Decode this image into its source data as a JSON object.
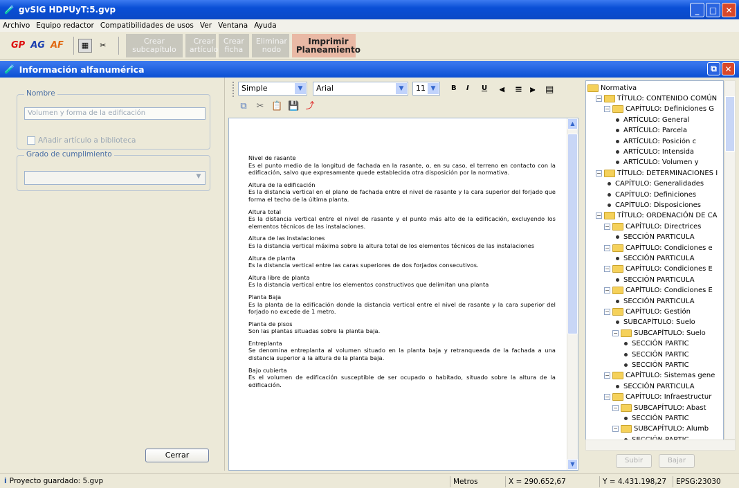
{
  "window": {
    "title": "gvSIG HDPUyT:5.gvp"
  },
  "menu": [
    "Archivo",
    "Equipo redactor",
    "Compatibilidades de usos",
    "Ver",
    "Ventana",
    "Ayuda"
  ],
  "toolbar": {
    "logos": [
      "GP",
      "AG",
      "AF"
    ],
    "buttons": [
      {
        "label": "Crear subcapítulo",
        "enabled": false
      },
      {
        "label": "Crear artículo",
        "enabled": false
      },
      {
        "label": "Crear ficha",
        "enabled": false
      },
      {
        "label": "Eliminar nodo",
        "enabled": false
      },
      {
        "label": "Imprimir Planeamiento",
        "enabled": true
      }
    ]
  },
  "frame": {
    "title": "Información alfanumérica"
  },
  "left": {
    "nombre_legend": "Nombre",
    "nombre_value": "Volumen y forma de la edificación",
    "add_checkbox": "Añadir artículo a biblioteca",
    "grado_legend": "Grado de cumplimiento",
    "grado_value": "",
    "close_label": "Cerrar"
  },
  "editor": {
    "style": "Simple",
    "font": "Arial",
    "size": "11",
    "format_buttons": [
      "B",
      "I",
      "U"
    ],
    "entries": [
      {
        "title": "Nivel de rasante",
        "text": "Es el punto medio de la longitud de fachada en la rasante, o, en su caso, el terreno en contacto con la edificación, salvo que expresamente quede establecida otra disposición por la normativa."
      },
      {
        "title": "Altura de la edificación",
        "text": "Es la distancia vertical en el plano de fachada entre el nivel de rasante y la cara superior del forjado que forma el techo de la última planta."
      },
      {
        "title": "Altura total",
        "text": "Es la distancia vertical entre el nivel de rasante y el punto más alto de la edificación, excluyendo los elementos técnicos de las instalaciones."
      },
      {
        "title": "Altura de las instalaciones",
        "text": "Es la distancia vertical máxima sobre la altura total de los elementos técnicos de las instalaciones"
      },
      {
        "title": "Altura de planta",
        "text": "Es la distancia vertical entre las caras superiores de dos forjados consecutivos."
      },
      {
        "title": "Altura libre de planta",
        "text": "Es la distancia vertical entre los elementos constructivos que delimitan una planta"
      },
      {
        "title": "Planta Baja",
        "text": "Es la planta de la edificación donde la distancia vertical entre el nivel de rasante y la cara superior del forjado no excede de 1 metro."
      },
      {
        "title": "Planta de pisos",
        "text": "Son las plantas situadas sobre la planta baja."
      },
      {
        "title": "Entreplanta",
        "text": "Se denomina entreplanta al volumen situado en la planta baja y retranqueada de la fachada a una distancia superior a la altura de la planta baja."
      },
      {
        "title": "Bajo cubierta",
        "text": "Es el volumen de edificación susceptible de ser ocupado o habitado, situado sobre la altura de la edificación."
      }
    ]
  },
  "tree": {
    "nodes": [
      {
        "label": "Normativa",
        "level": 0,
        "kind": "folder",
        "toggle": ""
      },
      {
        "label": "TÍTULO: CONTENIDO COMÚN",
        "level": 1,
        "kind": "folder",
        "toggle": "−"
      },
      {
        "label": "CAPÍTULO: Definiciones G",
        "level": 2,
        "kind": "folder",
        "toggle": "−"
      },
      {
        "label": "ARTÍCULO: General",
        "level": 3,
        "kind": "leaf",
        "toggle": ""
      },
      {
        "label": "ARTÍCULO: Parcela",
        "level": 3,
        "kind": "leaf",
        "toggle": ""
      },
      {
        "label": "ARTÍCULO: Posición c",
        "level": 3,
        "kind": "leaf",
        "toggle": ""
      },
      {
        "label": "ARTÍCULO: Intensida",
        "level": 3,
        "kind": "leaf",
        "toggle": ""
      },
      {
        "label": "ARTÍCULO: Volumen y",
        "level": 3,
        "kind": "leaf",
        "toggle": ""
      },
      {
        "label": "TÍTULO: DETERMINACIONES I",
        "level": 1,
        "kind": "folder",
        "toggle": "−"
      },
      {
        "label": "CAPÍTULO: Generalidades",
        "level": 2,
        "kind": "leaf",
        "toggle": ""
      },
      {
        "label": "CAPÍTULO: Definiciones",
        "level": 2,
        "kind": "leaf",
        "toggle": ""
      },
      {
        "label": "CAPÍTULO: Disposiciones",
        "level": 2,
        "kind": "leaf",
        "toggle": ""
      },
      {
        "label": "TÍTULO: ORDENACIÓN DE CA",
        "level": 1,
        "kind": "folder",
        "toggle": "−"
      },
      {
        "label": "CAPÍTULO: Directrices",
        "level": 2,
        "kind": "folder",
        "toggle": "−"
      },
      {
        "label": "SECCIÓN PARTICULA",
        "level": 3,
        "kind": "leaf",
        "toggle": ""
      },
      {
        "label": "CAPÍTULO: Condiciones e",
        "level": 2,
        "kind": "folder",
        "toggle": "−"
      },
      {
        "label": "SECCIÓN PARTICULA",
        "level": 3,
        "kind": "leaf",
        "toggle": ""
      },
      {
        "label": "CAPÍTULO: Condiciones E",
        "level": 2,
        "kind": "folder",
        "toggle": "−"
      },
      {
        "label": "SECCIÓN PARTICULA",
        "level": 3,
        "kind": "leaf",
        "toggle": ""
      },
      {
        "label": "CAPÍTULO: Condiciones E",
        "level": 2,
        "kind": "folder",
        "toggle": "−"
      },
      {
        "label": "SECCIÓN PARTICULA",
        "level": 3,
        "kind": "leaf",
        "toggle": ""
      },
      {
        "label": "CAPÍTULO: Gestión",
        "level": 2,
        "kind": "folder",
        "toggle": "−"
      },
      {
        "label": "SUBCAPÍTULO: Suelo",
        "level": 3,
        "kind": "leaf",
        "toggle": ""
      },
      {
        "label": "SUBCAPÍTULO: Suelo",
        "level": 3,
        "kind": "folder",
        "toggle": "−"
      },
      {
        "label": "SECCIÓN PARTIC",
        "level": 4,
        "kind": "leaf",
        "toggle": ""
      },
      {
        "label": "SECCIÓN PARTIC",
        "level": 4,
        "kind": "leaf",
        "toggle": ""
      },
      {
        "label": "SECCIÓN PARTIC",
        "level": 4,
        "kind": "leaf",
        "toggle": ""
      },
      {
        "label": "CAPÍTULO: Sistemas gene",
        "level": 2,
        "kind": "folder",
        "toggle": "−"
      },
      {
        "label": "SECCIÓN PARTICULA",
        "level": 3,
        "kind": "leaf",
        "toggle": ""
      },
      {
        "label": "CAPÍTULO: Infraestructur",
        "level": 2,
        "kind": "folder",
        "toggle": "−"
      },
      {
        "label": "SUBCAPÍTULO: Abast",
        "level": 3,
        "kind": "folder",
        "toggle": "−"
      },
      {
        "label": "SECCIÓN PARTIC",
        "level": 4,
        "kind": "leaf",
        "toggle": ""
      },
      {
        "label": "SUBCAPÍTULO: Alumb",
        "level": 3,
        "kind": "folder",
        "toggle": "−"
      },
      {
        "label": "SECCIÓN PARTIC",
        "level": 4,
        "kind": "leaf",
        "toggle": ""
      }
    ],
    "up_label": "Subir",
    "down_label": "Bajar"
  },
  "status": {
    "message": "Proyecto guardado: 5.gvp",
    "units": "Metros",
    "x": "X = 290.652,67",
    "y": "Y = 4.431.198,27",
    "epsg": "EPSG:23030"
  }
}
